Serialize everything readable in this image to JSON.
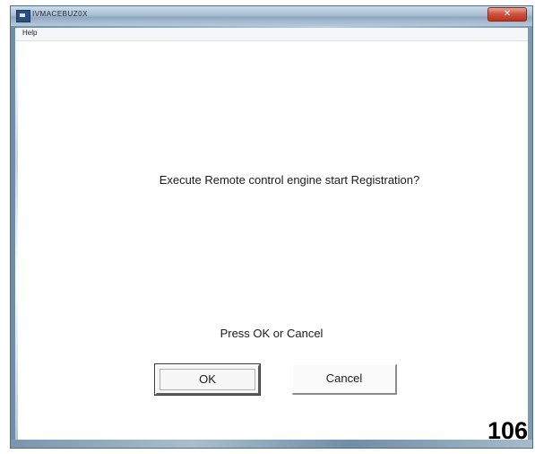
{
  "window": {
    "title": "IVMACEBUZ0X",
    "close_glyph": "✕",
    "icon": "app-window-icon"
  },
  "menu": {
    "help_label": "Help"
  },
  "dialog": {
    "prompt": "Execute Remote control engine start Registration?",
    "instruction": "Press OK or Cancel",
    "ok_label": "OK",
    "cancel_label": "Cancel"
  },
  "page_number": "106",
  "colors": {
    "titlebar": "#a8bed3",
    "close_button": "#cf4f3a",
    "client_background": "#ffffff",
    "button_face": "#f7f7f7"
  }
}
